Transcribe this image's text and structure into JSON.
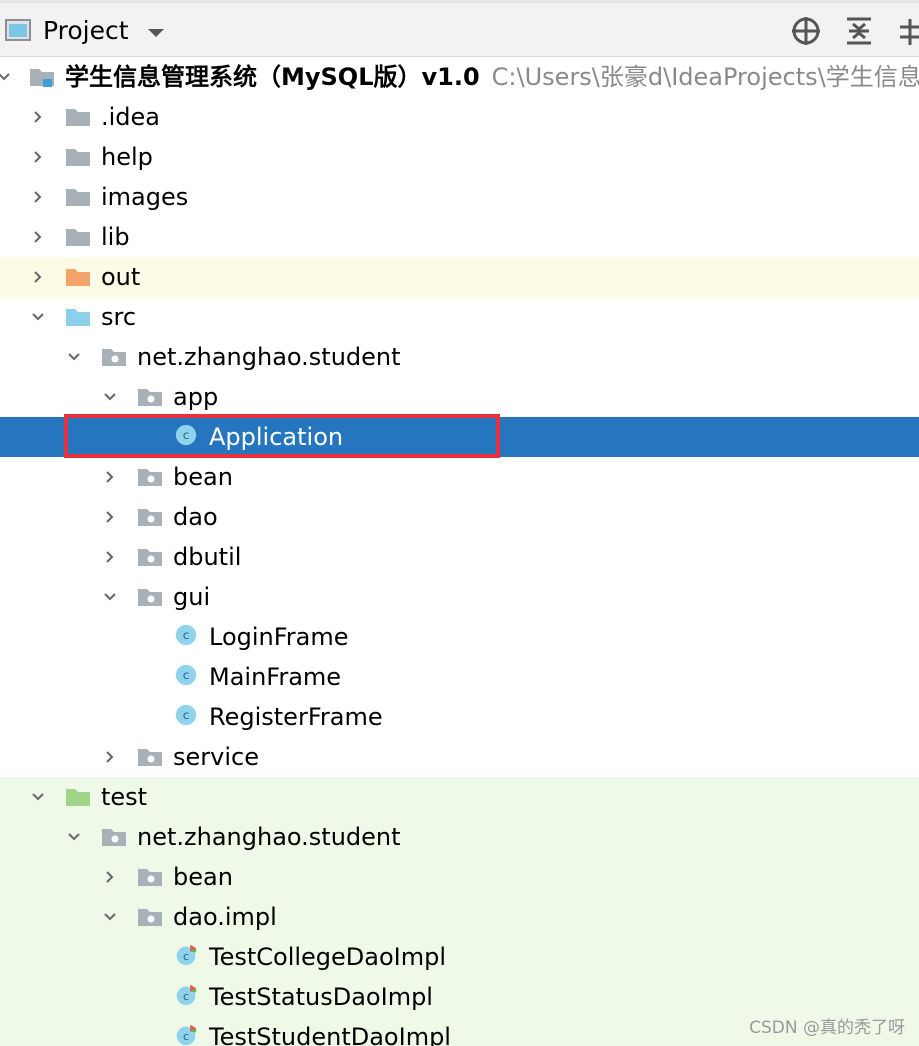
{
  "header": {
    "title": "Project",
    "icons": [
      "project-icon",
      "chevron-down-icon",
      "locate-icon",
      "collapse-all-icon",
      "settings-icon"
    ]
  },
  "tree": {
    "root": {
      "name": "学生信息管理系统（MySQL版）v1.0",
      "path": "C:\\Users\\张豪d\\IdeaProjects\\学生信息管"
    },
    "items": [
      {
        "label": ".idea"
      },
      {
        "label": "help"
      },
      {
        "label": "images"
      },
      {
        "label": "lib"
      },
      {
        "label": "out"
      },
      {
        "label": "src"
      },
      {
        "label": "net.zhanghao.student"
      },
      {
        "label": "app"
      },
      {
        "label": "Application"
      },
      {
        "label": "bean"
      },
      {
        "label": "dao"
      },
      {
        "label": "dbutil"
      },
      {
        "label": "gui"
      },
      {
        "label": "LoginFrame"
      },
      {
        "label": "MainFrame"
      },
      {
        "label": "RegisterFrame"
      },
      {
        "label": "service"
      },
      {
        "label": "test"
      },
      {
        "label": "net.zhanghao.student"
      },
      {
        "label": "bean"
      },
      {
        "label": "dao.impl"
      },
      {
        "label": "TestCollegeDaoImpl"
      },
      {
        "label": "TestStatusDaoImpl"
      },
      {
        "label": "TestStudentDaoImpl"
      }
    ]
  },
  "colors": {
    "selection": "#2675bf",
    "highlight_border": "#e8313a",
    "excluded_row": "#fdfbe5",
    "test_row": "#eef9e7",
    "folder_gray": "#a9b1b8",
    "folder_orange": "#f4a36b",
    "folder_blue": "#8ed0ec",
    "folder_green": "#9fd489",
    "class_icon": "#8fd3ec"
  },
  "watermark": "CSDN @真的秃了呀"
}
